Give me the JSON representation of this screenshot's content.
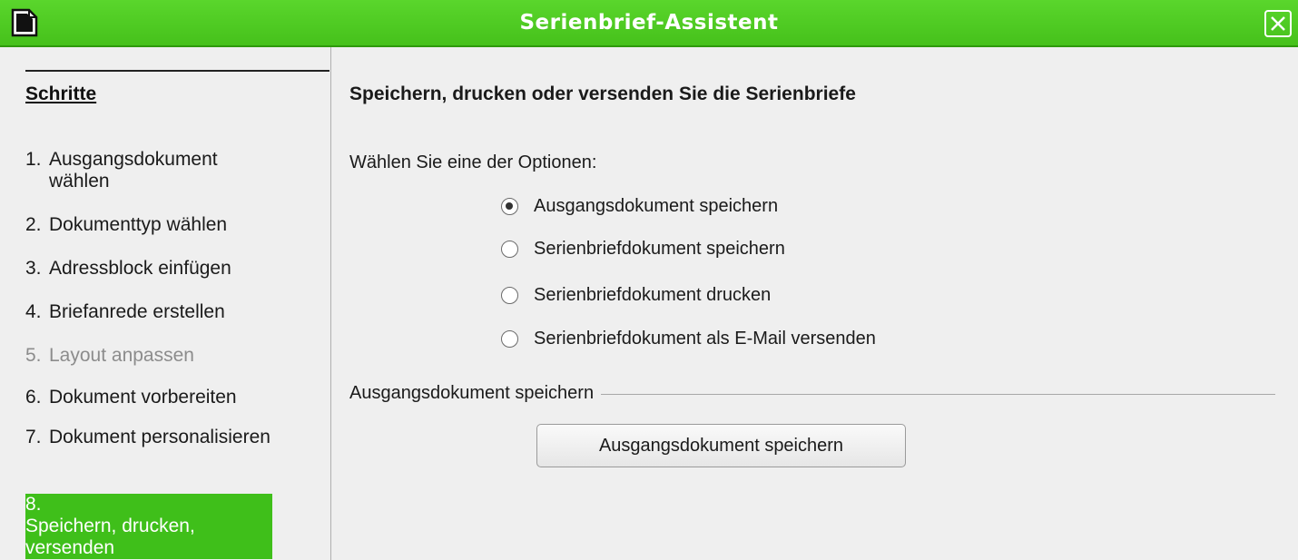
{
  "window": {
    "title": "Serienbrief-Assistent"
  },
  "steps": {
    "heading": "Schritte",
    "items": [
      {
        "num": "1.",
        "label": "Ausgangsdokument wählen",
        "state": "normal"
      },
      {
        "num": "2.",
        "label": "Dokumenttyp wählen",
        "state": "normal"
      },
      {
        "num": "3.",
        "label": "Adressblock einfügen",
        "state": "normal"
      },
      {
        "num": "4.",
        "label": "Briefanrede erstellen",
        "state": "normal"
      },
      {
        "num": "5.",
        "label": "Layout anpassen",
        "state": "disabled"
      },
      {
        "num": "6.",
        "label": "Dokument vorbereiten",
        "state": "normal"
      },
      {
        "num": "7.",
        "label": "Dokument personalisieren",
        "state": "normal"
      },
      {
        "num": "8.",
        "label": "Speichern, drucken, versenden",
        "state": "active"
      }
    ]
  },
  "main": {
    "title": "Speichern, drucken oder versenden Sie die Serienbriefe",
    "options_label": "Wählen Sie eine der Optionen:",
    "options": [
      {
        "label": "Ausgangsdokument speichern",
        "checked": true
      },
      {
        "label": "Serienbriefdokument speichern",
        "checked": false
      },
      {
        "label": "Serienbriefdokument drucken",
        "checked": false
      },
      {
        "label": "Serienbriefdokument als E-Mail versenden",
        "checked": false
      }
    ],
    "section_label": "Ausgangsdokument speichern",
    "save_button_label": "Ausgangsdokument speichern"
  },
  "colors": {
    "titlebar": "#46c11b",
    "active_step": "#3fbf1a"
  }
}
